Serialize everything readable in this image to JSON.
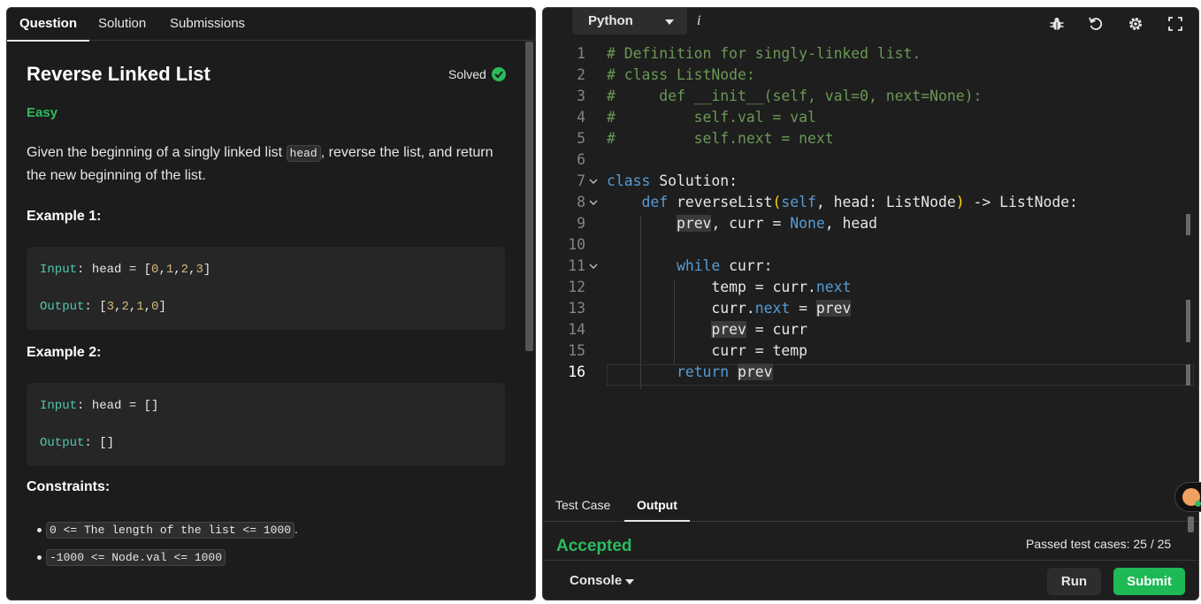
{
  "left": {
    "tabs": [
      {
        "label": "Question"
      },
      {
        "label": "Solution"
      },
      {
        "label": "Submissions"
      }
    ],
    "title": "Reverse Linked List",
    "status": "Solved",
    "difficulty": "Easy",
    "description": {
      "before": "Given the beginning of a singly linked list ",
      "code": "head",
      "after": ", reverse the list, and return the new beginning of the list."
    },
    "examples": [
      {
        "heading": "Example 1:",
        "input_label": "Input",
        "input_value": "head = [",
        "input_nums": [
          "0",
          "1",
          "2",
          "3"
        ],
        "output_label": "Output",
        "output_nums": [
          "3",
          "2",
          "1",
          "0"
        ]
      },
      {
        "heading": "Example 2:",
        "input_label": "Input",
        "input_value": "head = []",
        "output_label": "Output",
        "output_value": "[]"
      }
    ],
    "constraints_heading": "Constraints:",
    "constraints": [
      "0 <= The length of the list <= 1000",
      "-1000 <= Node.val <= 1000"
    ]
  },
  "editor": {
    "language": "Python",
    "info": "i",
    "toolbar_icons": [
      "bug-icon",
      "reset-icon",
      "settings-icon",
      "fullscreen-icon"
    ],
    "current_line": "16",
    "lines": [
      "1",
      "2",
      "3",
      "4",
      "5",
      "6",
      "7",
      "8",
      "9",
      "10",
      "11",
      "12",
      "13",
      "14",
      "15",
      "16"
    ]
  },
  "bottom": {
    "tabs": [
      {
        "label": "Test Case"
      },
      {
        "label": "Output"
      }
    ],
    "result": "Accepted",
    "passed": "Passed test cases: 25 / 25",
    "console": "Console",
    "run": "Run",
    "submit": "Submit"
  },
  "colors": {
    "accent_green": "#2cbb5d",
    "submit_green": "#1db954",
    "comment": "#6a9955",
    "keyword": "#569cd6"
  }
}
